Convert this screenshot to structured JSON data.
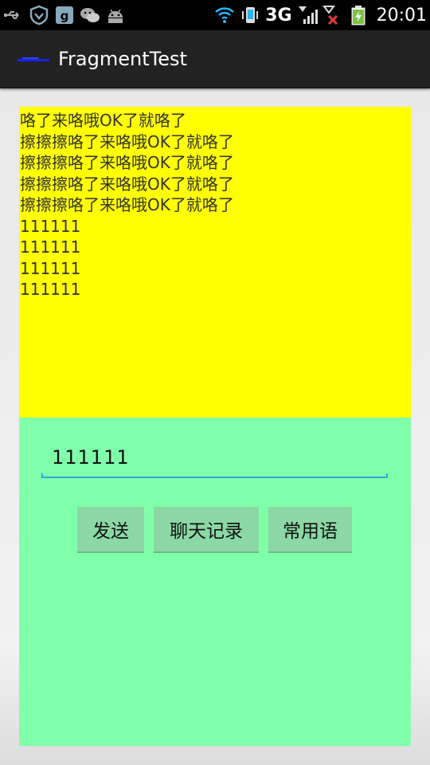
{
  "status_bar": {
    "icons_left": [
      "usb-icon",
      "shield-icon",
      "gallery-icon",
      "wechat-icon",
      "android-icon"
    ],
    "icons_right": [
      "wifi-icon",
      "phone-vibrate-icon",
      "signal-icon",
      "no-signal-icon",
      "battery-charging-icon"
    ],
    "network": "3G",
    "time": "20:01"
  },
  "action_bar": {
    "title": "FragmentTest",
    "icon": "app-logo-icon"
  },
  "chat": {
    "messages": [
      "咯了来咯哦OK了就咯了",
      "擦擦擦咯了来咯哦OK了就咯了",
      "擦擦擦咯了来咯哦OK了就咯了",
      "擦擦擦咯了来咯哦OK了就咯了",
      "擦擦擦咯了来咯哦OK了就咯了",
      "111111",
      "111111",
      "111111",
      "111111"
    ],
    "background": "#ffff00"
  },
  "input": {
    "value": "111111",
    "background": "#80ffaa",
    "underline_color": "#2aa6d8",
    "buttons": {
      "send": "发送",
      "history": "聊天记录",
      "phrases": "常用语"
    }
  }
}
